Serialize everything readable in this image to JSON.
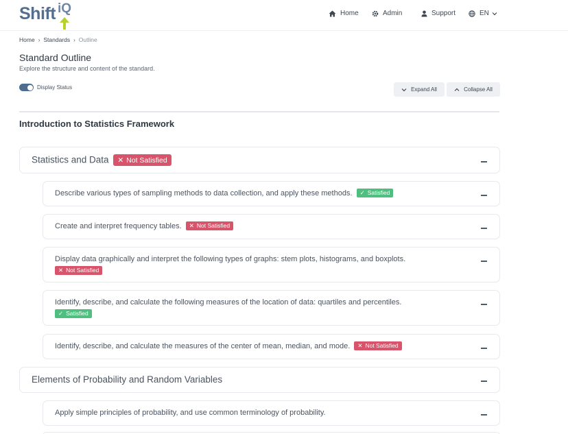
{
  "header": {
    "logo_text": "Shift",
    "logo_suffix": "iQ",
    "nav": [
      {
        "label": "Home",
        "icon": "home-icon"
      },
      {
        "label": "Admin",
        "icon": "gear-icon"
      },
      {
        "label": "Support",
        "icon": "user-icon"
      },
      {
        "label": "EN",
        "icon": "globe-icon"
      }
    ]
  },
  "breadcrumb": [
    "Home",
    "Standards",
    "Outline"
  ],
  "page": {
    "title": "Standard Outline",
    "subtitle": "Explore the structure and content of the standard.",
    "toggle_label": "Display Status",
    "toggle_on": true,
    "expand_label": "Expand All",
    "collapse_label": "Collapse All"
  },
  "framework": {
    "title": "Introduction to Statistics Framework"
  },
  "status": {
    "satisfied": "Satisfied",
    "not_satisfied": "Not Satisfied"
  },
  "colors": {
    "accent": "#4e6c8e",
    "satisfied": "#4fbf80",
    "not_satisfied": "#d8546b",
    "logo_arrow": "#b6d12a"
  },
  "sections": [
    {
      "title": "Statistics and Data",
      "status": "Not Satisfied",
      "items": [
        {
          "text": "Describe various types of sampling methods to data collection, and apply these methods.",
          "status": "Satisfied"
        },
        {
          "text": "Create and interpret frequency tables.",
          "status": "Not Satisfied"
        },
        {
          "text": "Display data graphically and interpret the following types of graphs: stem plots, histograms, and boxplots.",
          "status": "Not Satisfied"
        },
        {
          "text": "Identify, describe, and calculate the following measures of the location of data: quartiles and percentiles.",
          "status": "Satisfied"
        },
        {
          "text": "Identify, describe, and calculate the measures of the center of mean, median, and mode.",
          "status": "Not Satisfied"
        }
      ]
    },
    {
      "title": "Elements of Probability and Random Variables",
      "items": [
        {
          "text": "Apply simple principles of probability, and use common terminology of probability."
        }
      ]
    }
  ]
}
